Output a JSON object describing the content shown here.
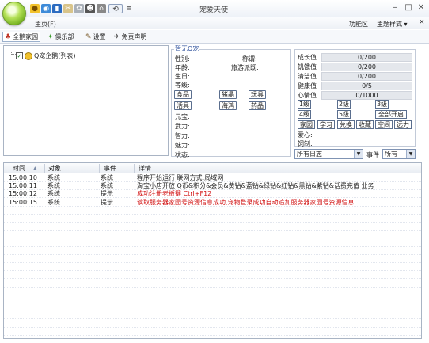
{
  "window": {
    "title": "宠爱天使",
    "home_tab": "主页(F)",
    "function_area": "功能区",
    "theme_style": "主题样式 ▾",
    "min": "–",
    "restore": "□",
    "close": "✕",
    "close_small": "×"
  },
  "toolbar": {
    "items": [
      {
        "label": "全鹅家园",
        "icon": "penguin-home-icon"
      },
      {
        "label": "俱乐部",
        "icon": "club-icon"
      },
      {
        "label": "设置",
        "icon": "settings-icon"
      },
      {
        "label": "免责声明",
        "icon": "disclaimer-icon"
      }
    ]
  },
  "tree": {
    "root_label": "Q宠企鹅(列表)"
  },
  "pet": {
    "group_title": "暂无Q宠",
    "fields": {
      "gender": "性别:",
      "nickname": "称谓:",
      "age": "年龄:",
      "travel": "旅游派既:",
      "birthday": "生日:",
      "level": "等级:",
      "yuanbao": "元宝:",
      "wuli": "武力:",
      "zhili": "智力:",
      "meili": "魅力:",
      "status": "状态:"
    },
    "buttons": [
      "食品",
      "猪晶",
      "玩具",
      "活具",
      "海鸿",
      "药品"
    ]
  },
  "stats": {
    "rows": [
      {
        "label": "成长值",
        "value": "0/200"
      },
      {
        "label": "饥饿值",
        "value": "0/200"
      },
      {
        "label": "清洁值",
        "value": "0/200"
      },
      {
        "label": "健康值",
        "value": "0/5"
      },
      {
        "label": "心情值",
        "value": "0/1000"
      }
    ],
    "level_buttons": [
      "1级",
      "2级",
      "3级",
      "4级",
      "5级",
      "全部开启"
    ],
    "action_buttons": [
      "家园",
      "学习",
      "兑换",
      "收藏",
      "空间",
      "远力"
    ],
    "love": "爱心:",
    "raise": "饲制:",
    "log_filter": "所有日志",
    "event_label": "事件",
    "event_filter": "所有"
  },
  "log": {
    "columns": [
      "时间",
      "对象",
      "事件",
      "详情"
    ],
    "rows": [
      {
        "time": "15:00:10",
        "object": "系统",
        "event": "系统",
        "detail": "程序开始运行 联网方式:局域网",
        "highlight": false
      },
      {
        "time": "15:00:11",
        "object": "系统",
        "event": "系统",
        "detail": "淘宝小店开放 Q币&积分&会员&黄钻&蓝钻&绿钻&红钻&黑钻&紫钻&话费充值 业务",
        "highlight": false
      },
      {
        "time": "15:00:12",
        "object": "系统",
        "event": "提示",
        "detail": "成功注册老板键  Ctrl+F12",
        "highlight": true
      },
      {
        "time": "15:00:15",
        "object": "系统",
        "event": "提示",
        "detail": "读取服务器家园号资源信息成功,宠物登录成功自动追加服务器家园号资源信息",
        "highlight": true
      }
    ]
  },
  "colors": {
    "accent_green": "#78b423",
    "highlight_red": "#d21414",
    "group_title_blue": "#2a4d9a"
  }
}
